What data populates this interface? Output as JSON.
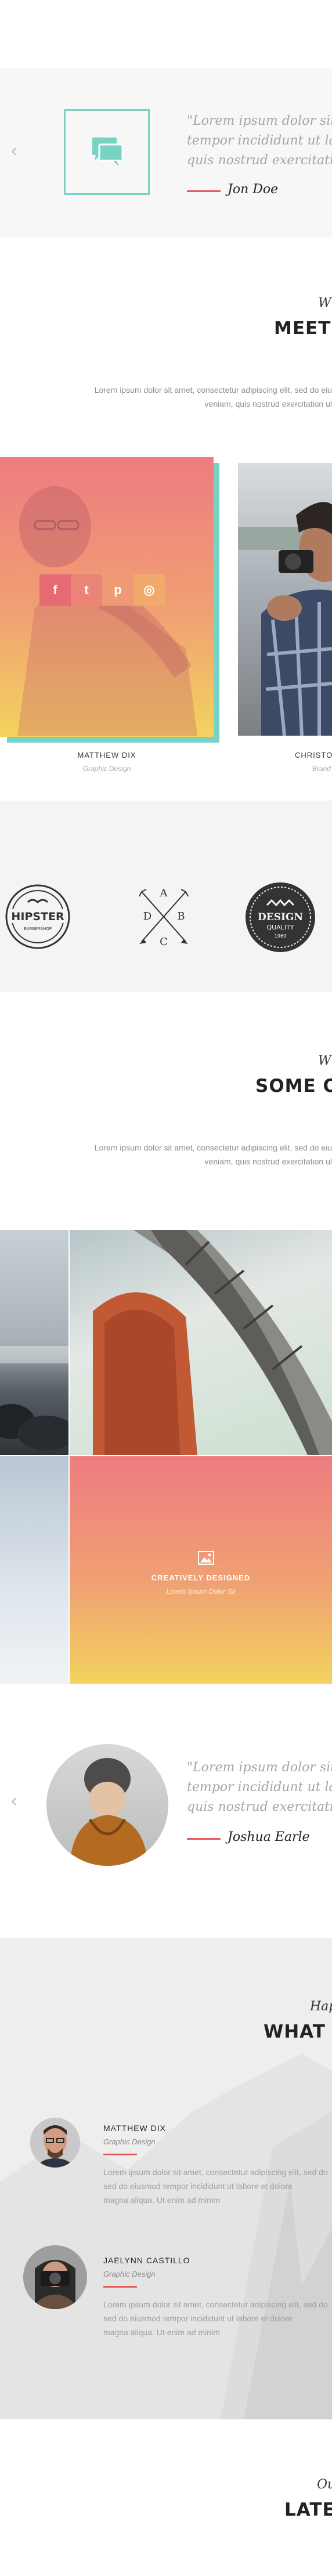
{
  "testimonial_1": {
    "quote_lines": [
      "\"Lorem ipsum dolor sit amet,",
      "tempor incididunt ut labo",
      "quis nostrud exercitation."
    ],
    "author": "Jon Doe",
    "icon": "chat-bubbles-icon",
    "prev_icon": "chevron-left-icon"
  },
  "team": {
    "eyebrow": "W",
    "title": "MEET O",
    "lead_lines": [
      "Lorem ipsum dolor sit amet, consectetur adipiscing elit, sed do eiu",
      "veniam, quis nostrud exercitation ul"
    ],
    "members": [
      {
        "name": "MATTHEW DIX",
        "role": "Graphic Design"
      },
      {
        "name": "CHRISTO",
        "role": "Brand"
      }
    ],
    "social_icons": [
      "facebook-icon",
      "twitter-icon",
      "pinterest-icon",
      "instagram-icon"
    ],
    "social_glyphs": [
      "f",
      "t",
      "p",
      "◎"
    ]
  },
  "logos": {
    "hipster": {
      "top": "HIPSTER",
      "bottom": "BARBERSHOP"
    },
    "arrows": {
      "letters": [
        "A",
        "B",
        "C",
        "D"
      ]
    },
    "design": {
      "line1": "DESIGN",
      "line2": "QUALITY",
      "line3": "1969"
    }
  },
  "portfolio": {
    "eyebrow": "W",
    "title": "SOME OF",
    "lead_lines": [
      "Lorem ipsum dolor sit amet, consectetur adipiscing elit, sed do eiu",
      "veniam, quis nostrud exercitation ul"
    ],
    "overlay_title": "CREATIVELY DESIGNED",
    "overlay_sub": "Lorem Ipsum Dolor Sit",
    "overlay_icon": "image-icon"
  },
  "testimonial_2": {
    "quote_lines": [
      "\"Lorem ipsum dolor sit a",
      "tempor incididunt ut labo",
      "quis nostrud exercitation."
    ],
    "author": "Joshua Earle",
    "prev_icon": "chevron-left-icon"
  },
  "happy": {
    "eyebrow": "Hap",
    "title": "WHAT P",
    "people": [
      {
        "name": "MATTHEW DIX",
        "role": "Graphic Design",
        "text": [
          "Lorem ipsum dolor sit amet, consectetur adipiscing elit, sed do",
          "sed do eiusmod tempor incididunt ut labore et dolore",
          "magna aliqua. Ut enim ad minim"
        ]
      },
      {
        "name": "JAELYNN CASTILLO",
        "role": "Graphic Design",
        "text": [
          "Lorem ipsum dolor sit amet, consectetur adipiscing elit, sed do",
          "sed do eiusmod tempor incididunt ut labore et dolore",
          "magna aliqua. Ut enim ad minim"
        ]
      }
    ]
  },
  "latest": {
    "eyebrow": "Ou",
    "title": "LATE"
  },
  "colors": {
    "accent": "#e45b5b",
    "teal": "#79d3c5",
    "gradient_top": "#ef7a7f",
    "gradient_bottom": "#f4d25f"
  }
}
